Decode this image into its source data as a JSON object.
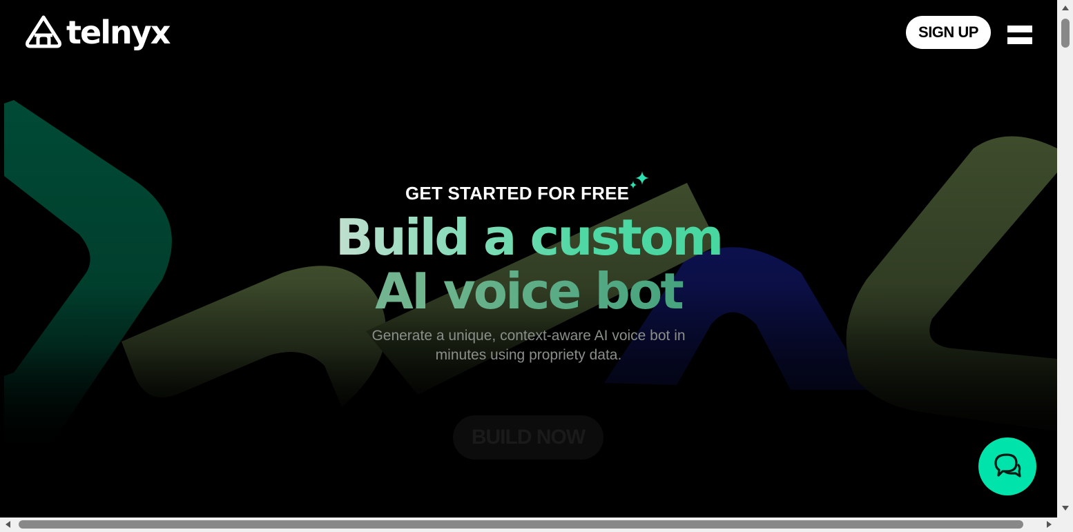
{
  "brand": {
    "name": "telnyx",
    "logo_icon": "telnyx-logo-icon"
  },
  "header": {
    "signup_label": "SIGN UP",
    "menu_icon": "hamburger-menu-icon"
  },
  "hero": {
    "eyebrow": "GET STARTED FOR FREE",
    "sparkle_icon": "sparkle-icon",
    "headline_line1": "Build a custom",
    "headline_line2": "AI voice bot",
    "subtext_line1": "Generate a unique, context-aware AI voice bot in",
    "subtext_line2": "minutes using propriety data.",
    "cta_label": "BUILD NOW"
  },
  "chat": {
    "icon": "chat-bubbles-icon"
  },
  "colors": {
    "background": "#000000",
    "accent": "#00e3aa",
    "shape_green_dark": "#004a35",
    "shape_olive": "#3b4a2b",
    "shape_navy": "#0b0f4a"
  }
}
